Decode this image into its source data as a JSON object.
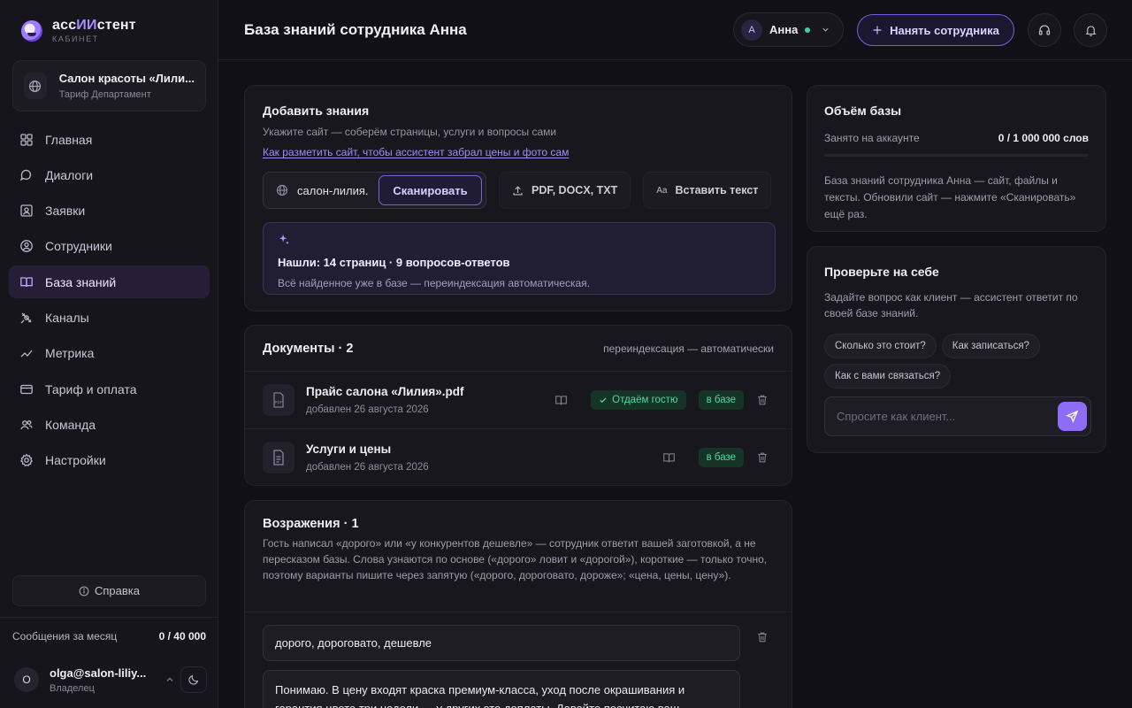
{
  "brand": {
    "name_prefix": "асс",
    "name_accent": "ИИ",
    "name_suffix": "стент",
    "sub": "КАБИНЕТ"
  },
  "org": {
    "name": "Салон красоты «Лили...",
    "plan": "Тариф Департамент"
  },
  "nav": [
    {
      "label": "Главная",
      "icon": "grid-icon",
      "active": false
    },
    {
      "label": "Диалоги",
      "icon": "chat-icon",
      "active": false
    },
    {
      "label": "Заявки",
      "icon": "inbox-icon",
      "active": false
    },
    {
      "label": "Сотрудники",
      "icon": "user-circle-icon",
      "active": false
    },
    {
      "label": "База знаний",
      "icon": "book-icon",
      "active": true
    },
    {
      "label": "Каналы",
      "icon": "satellite-icon",
      "active": false
    },
    {
      "label": "Метрика",
      "icon": "chart-line-icon",
      "active": false
    },
    {
      "label": "Тариф и оплата",
      "icon": "credit-card-icon",
      "active": false
    },
    {
      "label": "Команда",
      "icon": "users-icon",
      "active": false
    },
    {
      "label": "Настройки",
      "icon": "gear-icon",
      "active": false
    }
  ],
  "help_label": "Справка",
  "messages": {
    "label": "Сообщения за месяц",
    "value": "0 / 40 000"
  },
  "user": {
    "initial": "O",
    "email": "olga@salon-liliy...",
    "role": "Владелец"
  },
  "topbar": {
    "title": "База знаний сотрудника Анна",
    "employee": {
      "initial": "А",
      "name": "Анна"
    },
    "hire_label": "Нанять сотрудника"
  },
  "add_knowledge": {
    "title": "Добавить знания",
    "description": "Укажите сайт — соберём страницы, услуги и вопросы сами",
    "link": "Как разметить сайт, чтобы ассистент забрал цены и фото сам",
    "url_value": "салон-лилия.",
    "scan_label": "Сканировать",
    "upload_label": "PDF, DOCX, TXT",
    "paste_label": "Вставить текст",
    "paste_icon_text": "Aa",
    "found_title": "Нашли: 14 страниц · 9 вопросов-ответов",
    "found_sub": "Всё найденное уже в базе — переиндексация автоматическая."
  },
  "documents": {
    "title": "Документы · 2",
    "note": "переиндексация — автоматически",
    "items": [
      {
        "name": "Прайс салона «Лилия».pdf",
        "date": "добавлен 26 августа 2026",
        "guest_badge": "Отдаём гостю",
        "base_badge": "в базе",
        "icon_label": "PDF"
      },
      {
        "name": "Услуги и цены",
        "date": "добавлен 26 августа 2026",
        "guest_badge": null,
        "base_badge": "в базе",
        "icon_label": ""
      }
    ]
  },
  "objections": {
    "title": "Возражения · 1",
    "description": "Гость написал «дорого» или «у конкурентов дешевле» — сотрудник ответит вашей заготовкой, а не пересказом базы. Слова узнаются по основе («дорого» ловит и «дорогой»), короткие — только точно, поэтому варианты пишите через запятую («дорого, дороговато, дороже»; «цена, цены, цену»).",
    "triggers": "дорого, дороговато, дешевле",
    "answer": "Понимаю. В цену входят краска премиум-класса, уход после окрашивания и гарантия цвета три недели — у других это доплаты. Давайте посчитаю ваш"
  },
  "volume": {
    "title": "Объём базы",
    "label": "Занято на аккаунте",
    "value": "0 / 1 000 000 слов",
    "fill_fraction": 0,
    "text": "База знаний сотрудника Анна — сайт, файлы и тексты. Обновили сайт — нажмите «Сканировать» ещё раз."
  },
  "test": {
    "title": "Проверьте на себе",
    "description": "Задайте вопрос как клиент — ассистент ответит по своей базе знаний.",
    "chips": [
      "Сколько это стоит?",
      "Как записаться?",
      "Как с вами связаться?"
    ],
    "placeholder": "Спросите как клиент..."
  },
  "colors": {
    "accent": "#8f6cf5",
    "success": "#4fd8a4",
    "online": "#38d39f",
    "background": "#111016"
  }
}
